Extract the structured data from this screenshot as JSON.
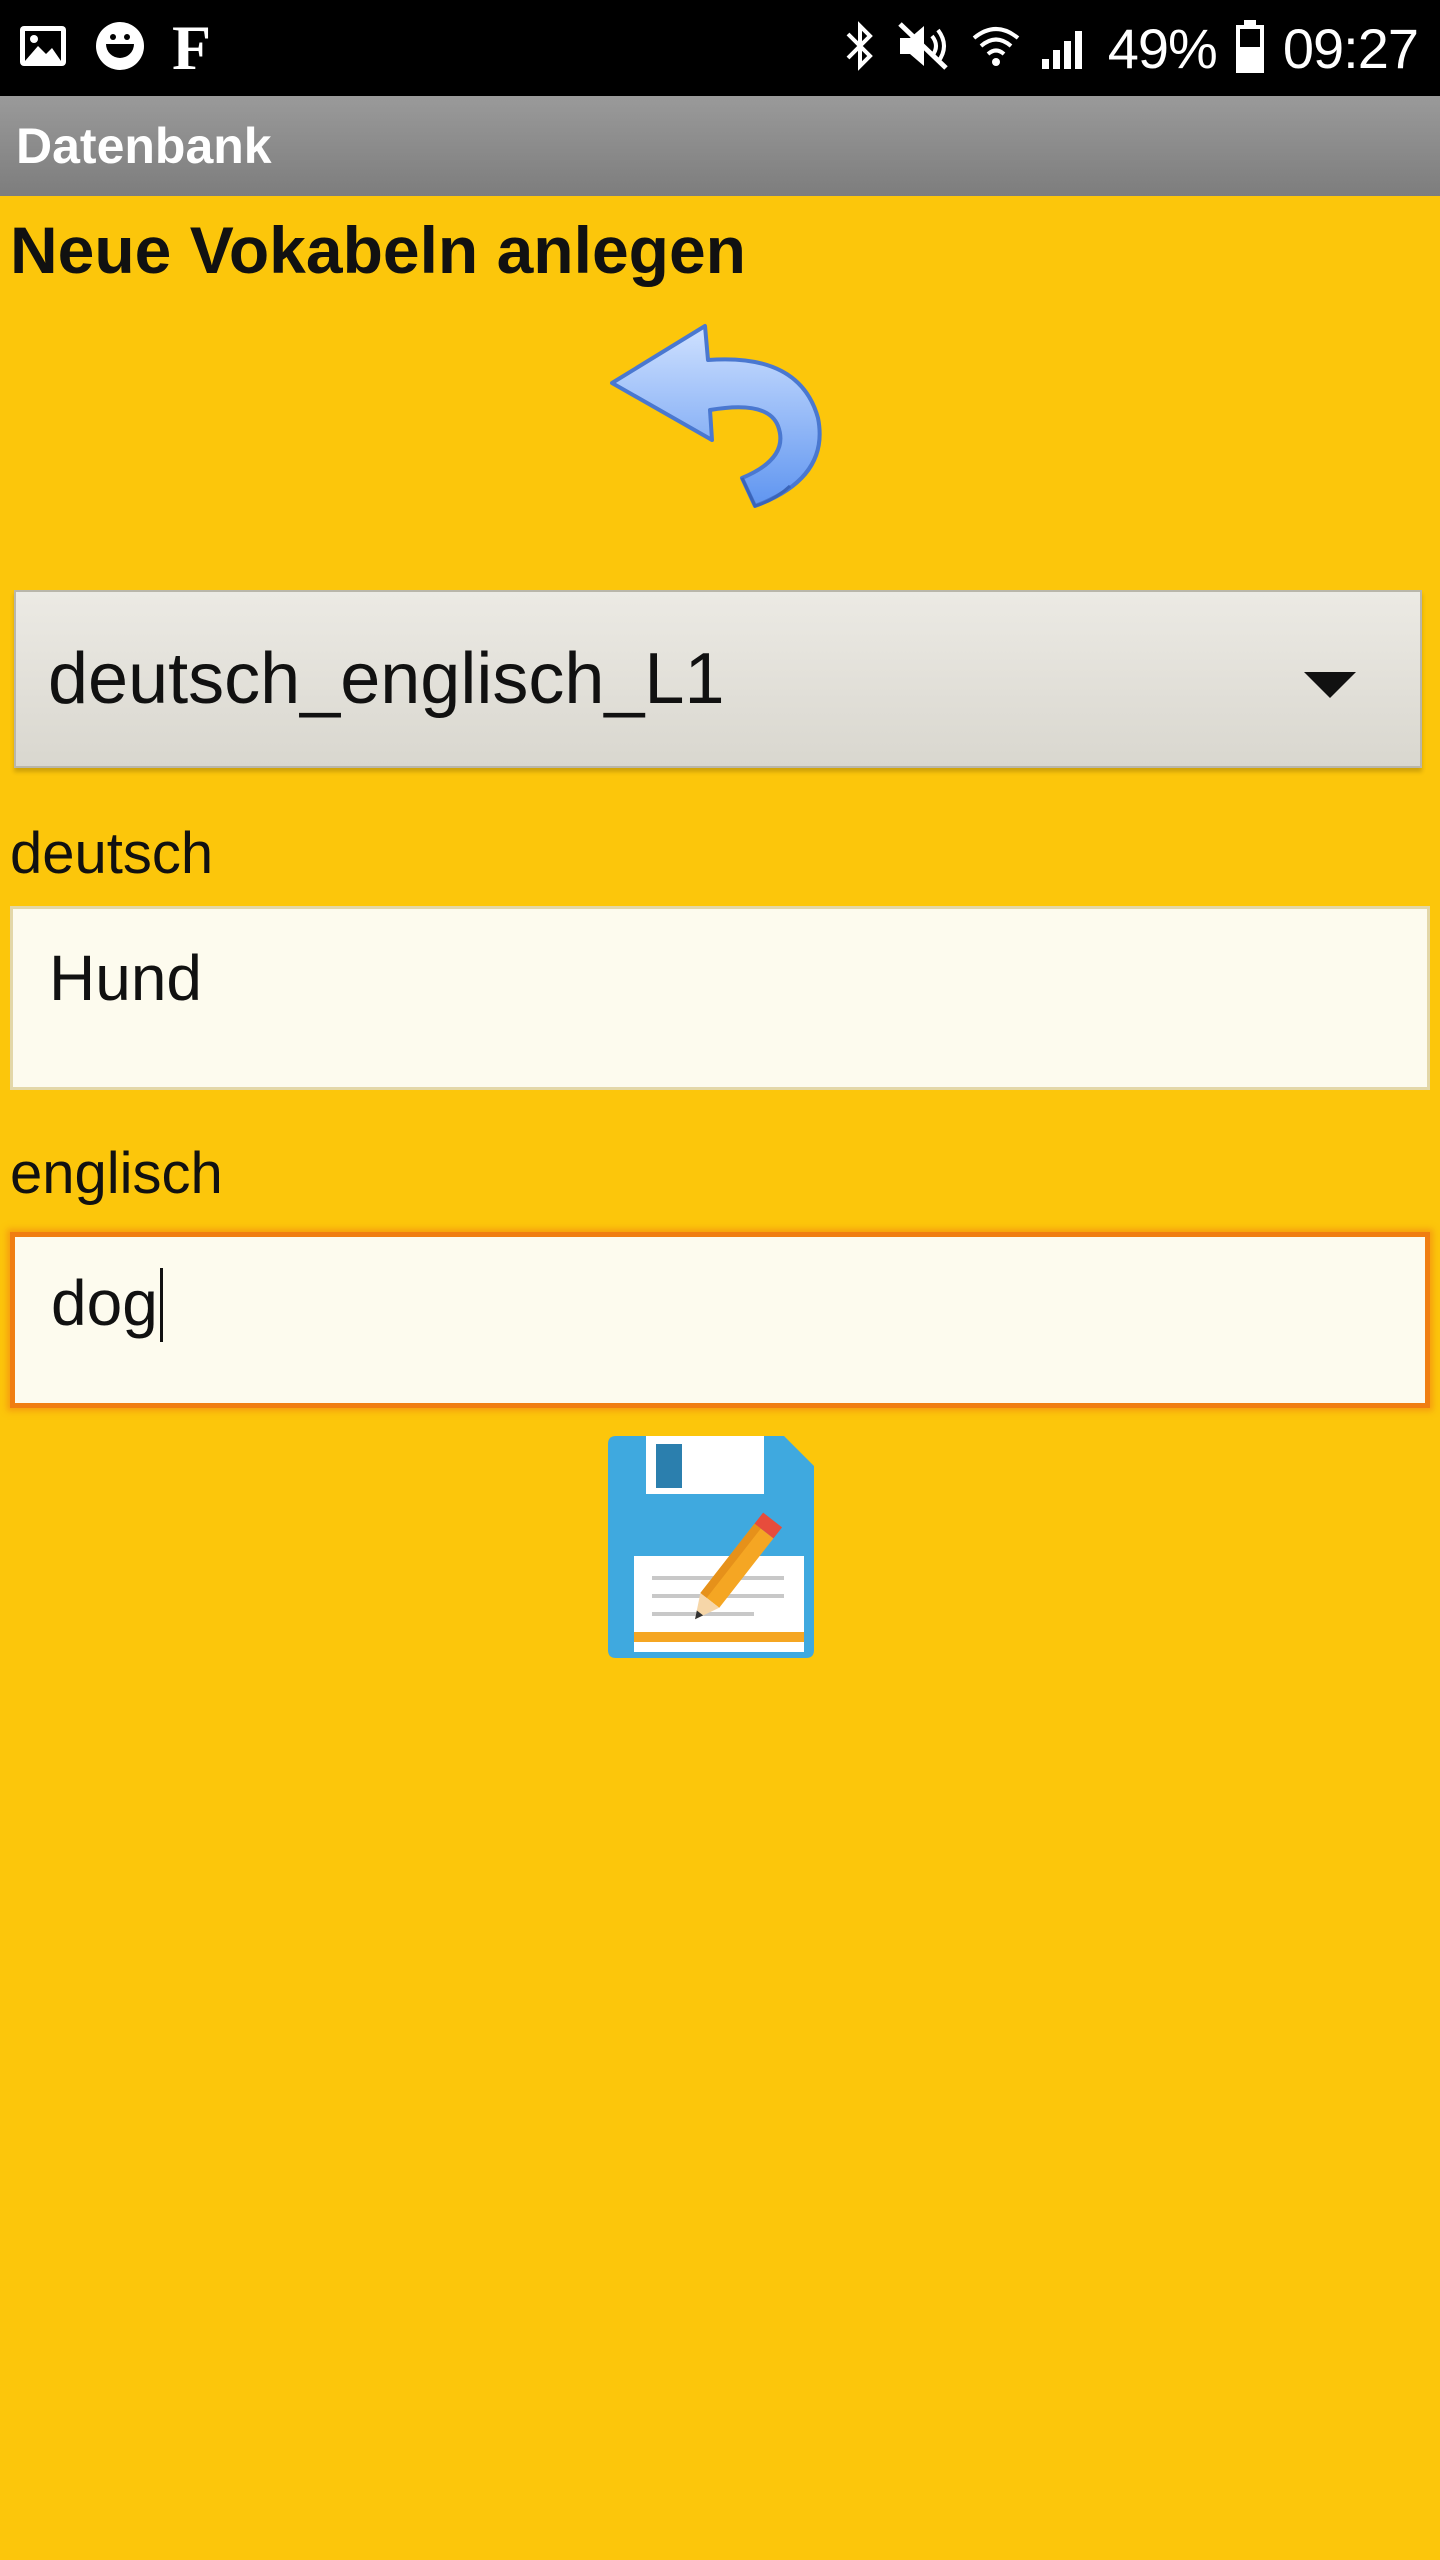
{
  "status_bar": {
    "battery": "49%",
    "time": "09:27",
    "left_icons": [
      "gallery-icon",
      "smiley-icon",
      "f-icon"
    ],
    "right_icons": [
      "bluetooth-icon",
      "mute-icon",
      "wifi-icon",
      "signal-icon",
      "battery-icon"
    ],
    "f_glyph": "F"
  },
  "app_bar": {
    "title": "Datenbank"
  },
  "page": {
    "heading": "Neue Vokabeln anlegen"
  },
  "actions": {
    "back_icon": "back-arrow-icon",
    "save_icon": "save-floppy-pencil-icon"
  },
  "dropdown": {
    "selected": "deutsch_englisch_L1"
  },
  "form": {
    "german_label": "deutsch",
    "german_value": "Hund",
    "english_label": "englisch",
    "english_value": "dog"
  },
  "colors": {
    "background": "#FCC60B",
    "focus_border": "#F07E12",
    "field_background": "#FDFBEE"
  }
}
